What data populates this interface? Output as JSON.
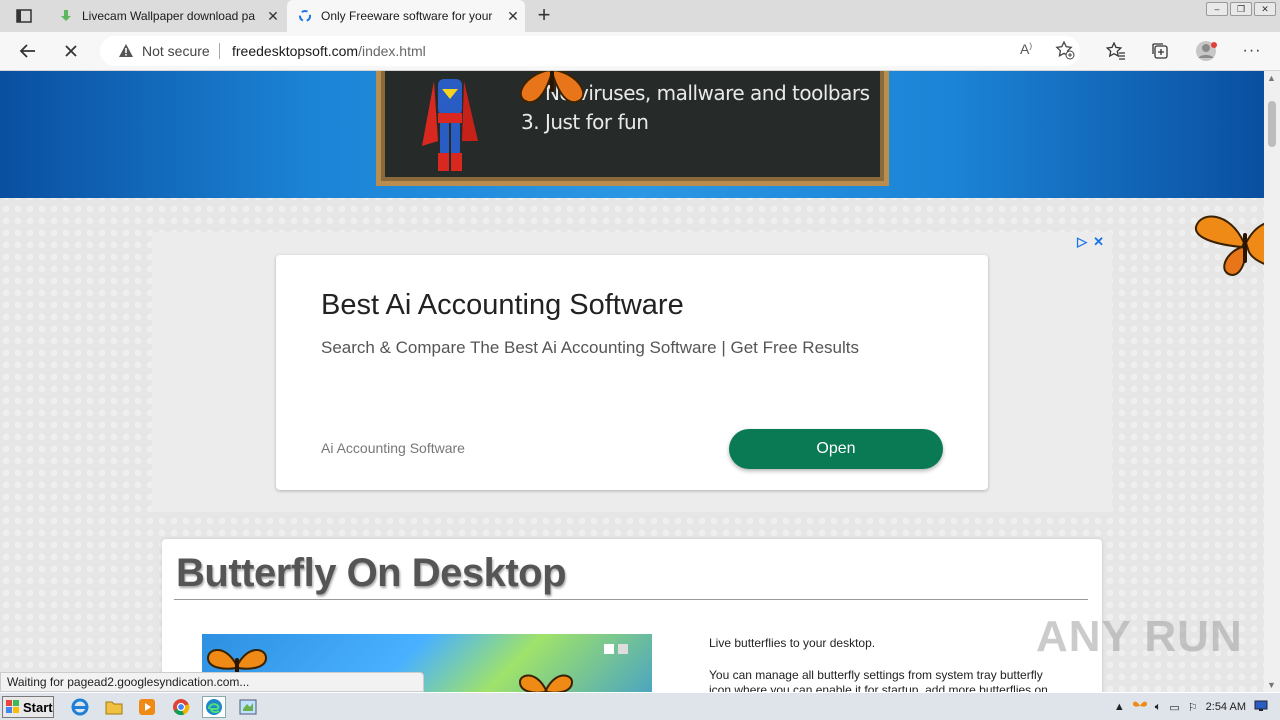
{
  "browser": {
    "tabs": [
      {
        "title": "Livecam Wallpaper download pa",
        "active": false
      },
      {
        "title": "Only Freeware software for your",
        "active": true
      }
    ],
    "address": {
      "security_label": "Not secure",
      "host": "freedesktopsoft.com",
      "path": "/index.html"
    },
    "status_text": "Waiting for pagead2.googlesyndication.com..."
  },
  "banner": {
    "lines": [
      "2. No viruses, mallware and toolbars",
      "3. Just for fun"
    ]
  },
  "ad": {
    "title": "Best Ai Accounting Software",
    "subtitle": "Search & Compare The Best Ai Accounting Software | Get Free Results",
    "footer_label": "Ai Accounting Software",
    "button_label": "Open"
  },
  "content": {
    "heading": "Butterfly On Desktop",
    "paragraphs": [
      "Live butterflies to your desktop.",
      "You can manage all butterfly settings from system tray butterfly",
      "icon where you can enable it for startup, add more butterflies on"
    ]
  },
  "watermark": "ANY RUN",
  "taskbar": {
    "start_label": "Start",
    "clock": "2:54 AM"
  },
  "colors": {
    "ad_button": "#0a7a55",
    "banner_blue": "#1c84d6"
  }
}
